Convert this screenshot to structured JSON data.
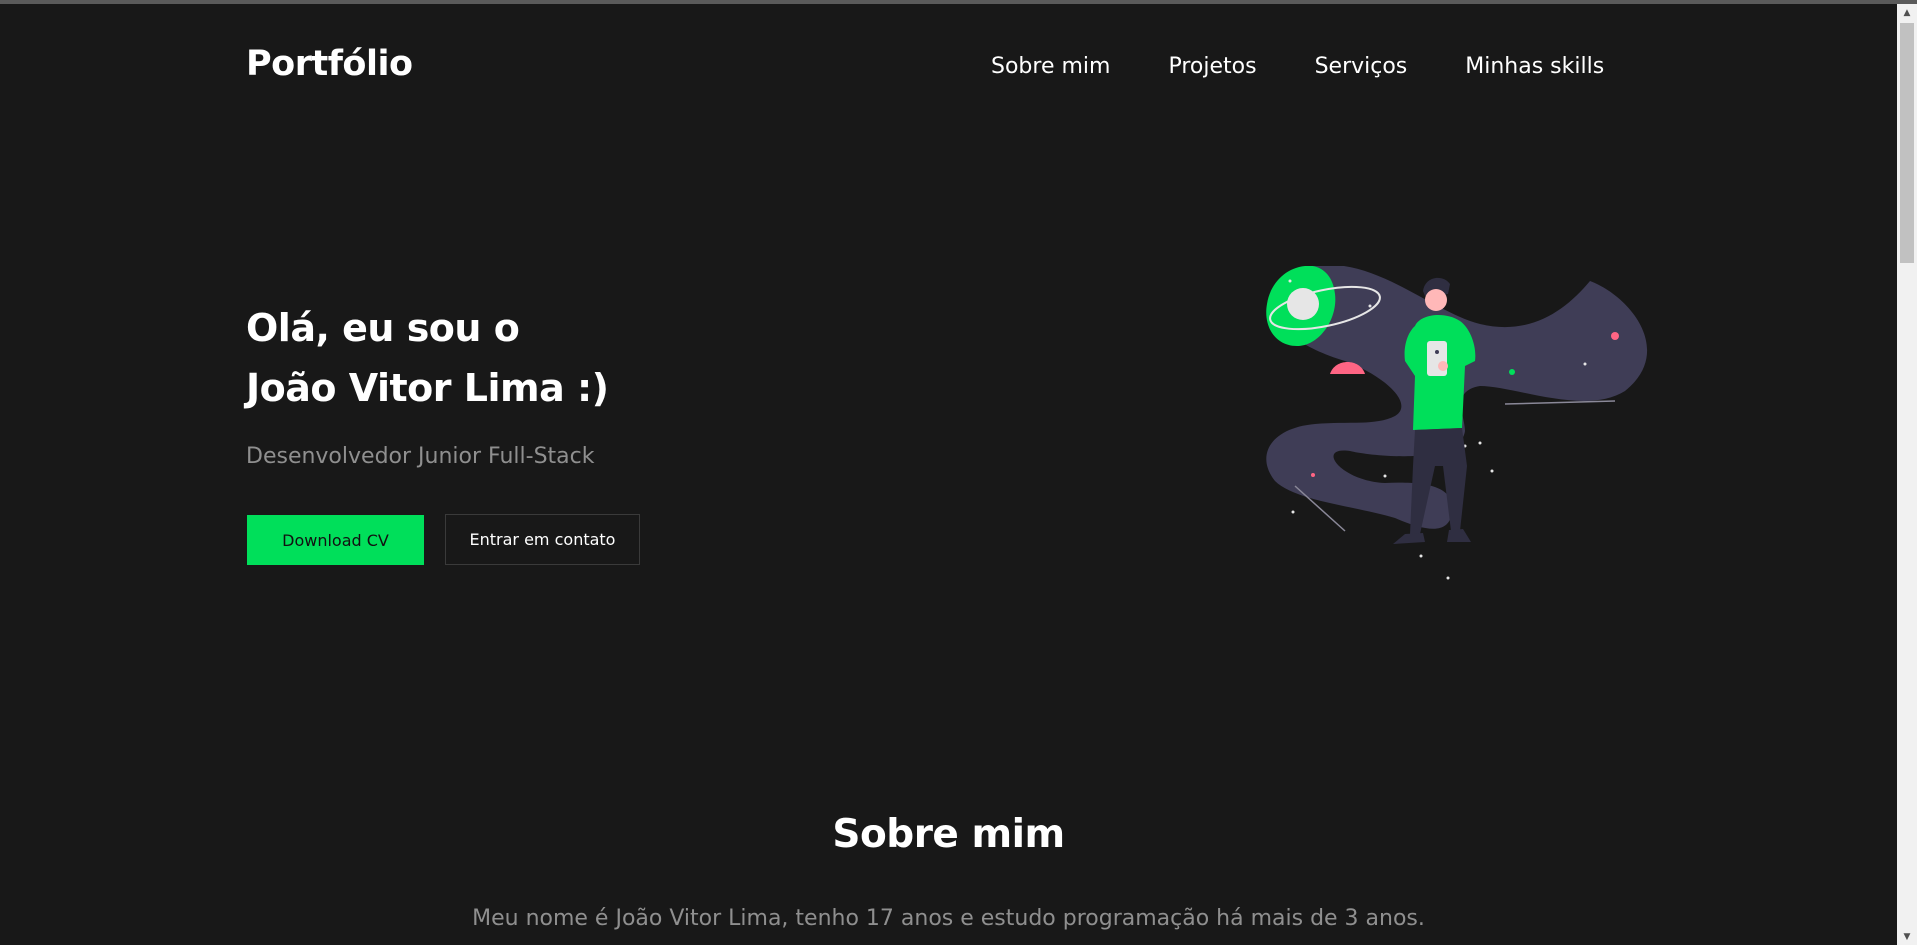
{
  "header": {
    "logo": "Portfólio",
    "nav": [
      {
        "label": "Sobre mim"
      },
      {
        "label": "Projetos"
      },
      {
        "label": "Serviços"
      },
      {
        "label": "Minhas skills"
      }
    ]
  },
  "hero": {
    "greeting_line1": "Olá, eu sou o",
    "greeting_line2": "João Vitor Lima :)",
    "subtitle": "Desenvolvedor Junior Full-Stack",
    "download_button": "Download CV",
    "contact_button": "Entrar em contato",
    "illustration_icon": "space-person-illustration"
  },
  "about": {
    "title": "Sobre mim",
    "text": "Meu nome é João Vitor Lima, tenho 17 anos e estudo programação há mais de 3 anos."
  },
  "colors": {
    "background": "#181818",
    "accent": "#00df5a",
    "text": "#ffffff",
    "muted": "#8f8f8f",
    "illustration_blob": "#3f3d56",
    "illustration_pink": "#ff6584"
  }
}
